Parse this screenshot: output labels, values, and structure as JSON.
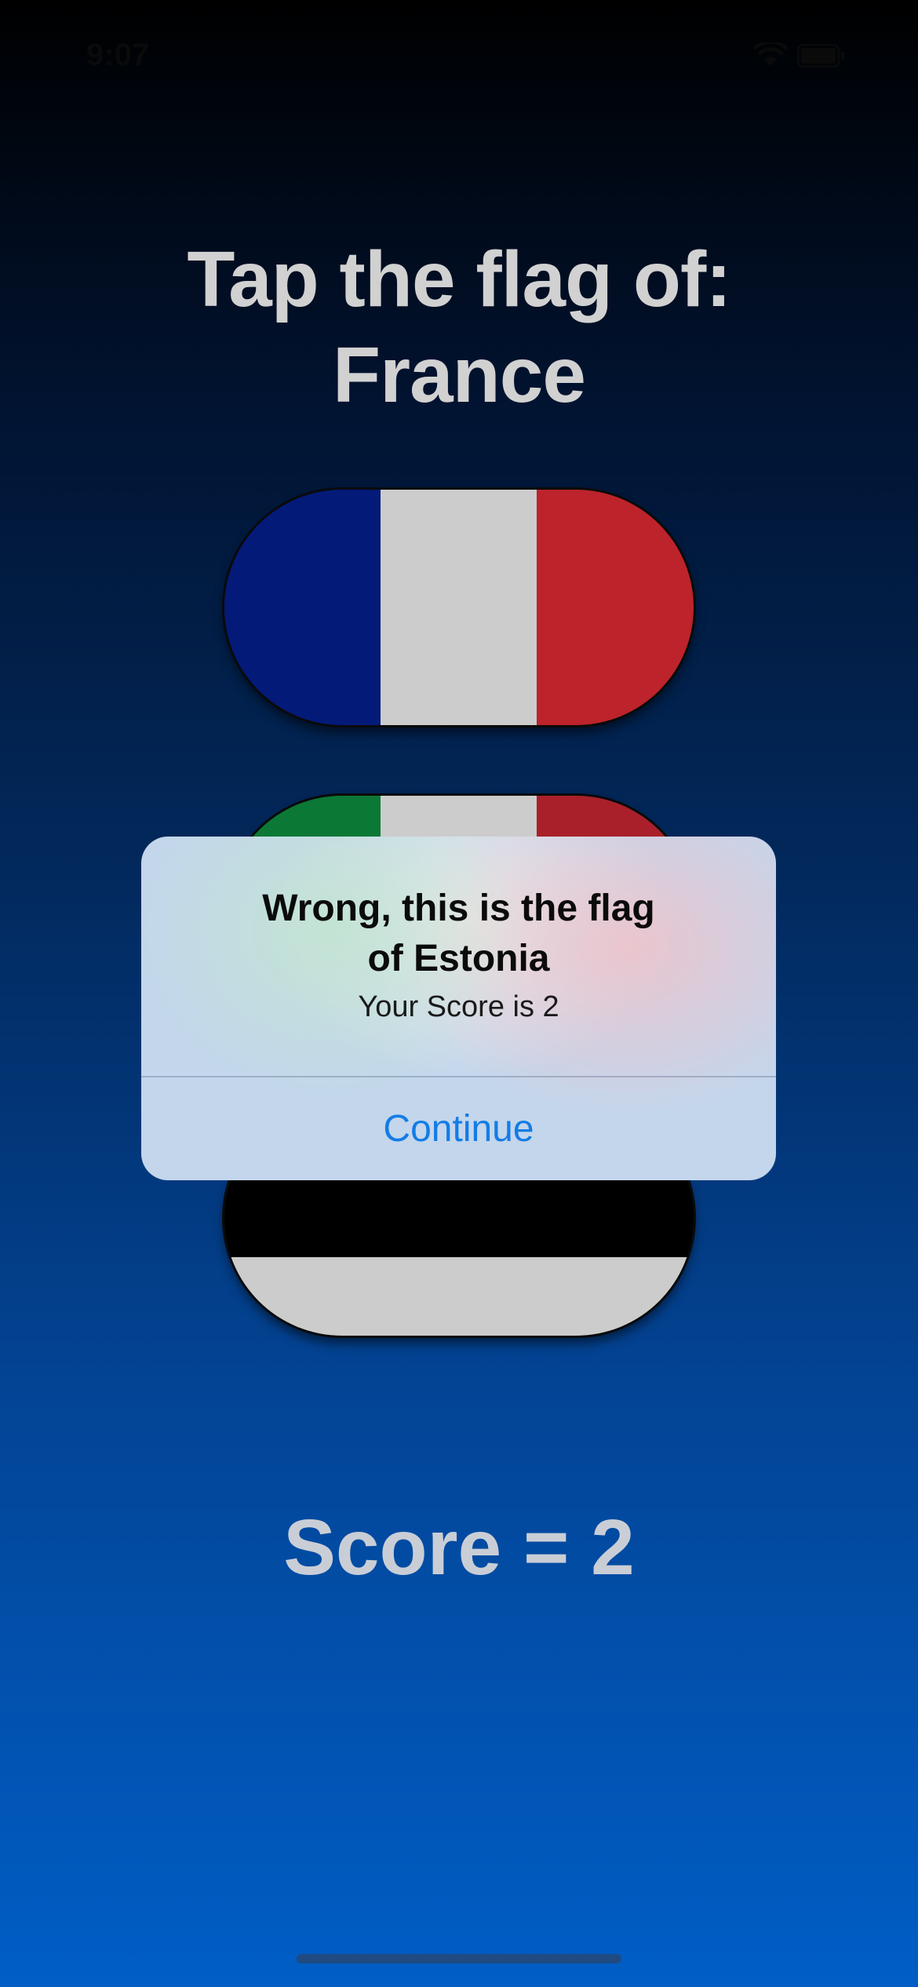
{
  "status_bar": {
    "time": "9:07",
    "icons": [
      "wifi-icon",
      "battery-icon"
    ]
  },
  "prompt": {
    "line1": "Tap the flag of:",
    "line2": "France"
  },
  "flags": [
    {
      "country": "France",
      "colors": [
        "#031a78",
        "#cccccc",
        "#bd232b"
      ]
    },
    {
      "country": "Italy",
      "colors": [
        "#0c7836",
        "#cccccc",
        "#a9202a"
      ]
    },
    {
      "country": "Estonia",
      "colors": [
        "#0072ce",
        "#000000",
        "#cccccc"
      ]
    }
  ],
  "alert": {
    "title_line1": "Wrong, this is the flag",
    "title_line2": "of Estonia",
    "message": "Your Score is 2",
    "button": "Continue"
  },
  "score_label": "Score = 2",
  "colors": {
    "text_light": "#d1d1d1",
    "alert_button": "#147ce6",
    "gradient_top": "#000000",
    "gradient_bottom": "#005ec6"
  }
}
